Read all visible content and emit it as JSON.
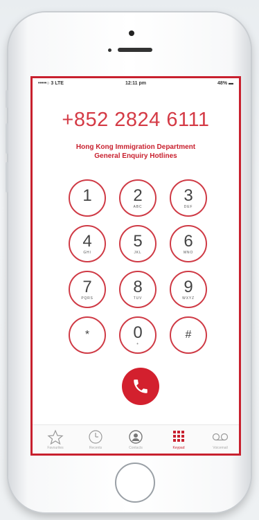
{
  "status_bar": {
    "carrier": "•••••○ 3  LTE",
    "time": "12:11 pm",
    "battery": "48% ▬"
  },
  "dialer": {
    "number": "+852 2824 6111",
    "caption_line1": "Hong Kong Immigration Department",
    "caption_line2": "General Enquiry Hotlines"
  },
  "keypad": [
    {
      "digit": "1",
      "letters": ""
    },
    {
      "digit": "2",
      "letters": "ABC"
    },
    {
      "digit": "3",
      "letters": "DEF"
    },
    {
      "digit": "4",
      "letters": "GHI"
    },
    {
      "digit": "5",
      "letters": "JKL"
    },
    {
      "digit": "6",
      "letters": "MNO"
    },
    {
      "digit": "7",
      "letters": "PQRS"
    },
    {
      "digit": "8",
      "letters": "TUV"
    },
    {
      "digit": "9",
      "letters": "WXYZ"
    },
    {
      "digit": "*",
      "letters": ""
    },
    {
      "digit": "0",
      "letters": "+"
    },
    {
      "digit": "#",
      "letters": ""
    }
  ],
  "tabs": [
    {
      "label": "Favourites",
      "icon": "star-icon"
    },
    {
      "label": "Recents",
      "icon": "clock-icon"
    },
    {
      "label": "Contacts",
      "icon": "contact-icon"
    },
    {
      "label": "Keypad",
      "icon": "keypad-icon",
      "active": true
    },
    {
      "label": "Voicemail",
      "icon": "voicemail-icon"
    }
  ],
  "colors": {
    "accent": "#c8202e",
    "key_ring": "#cf3a45",
    "call": "#d3202e"
  }
}
